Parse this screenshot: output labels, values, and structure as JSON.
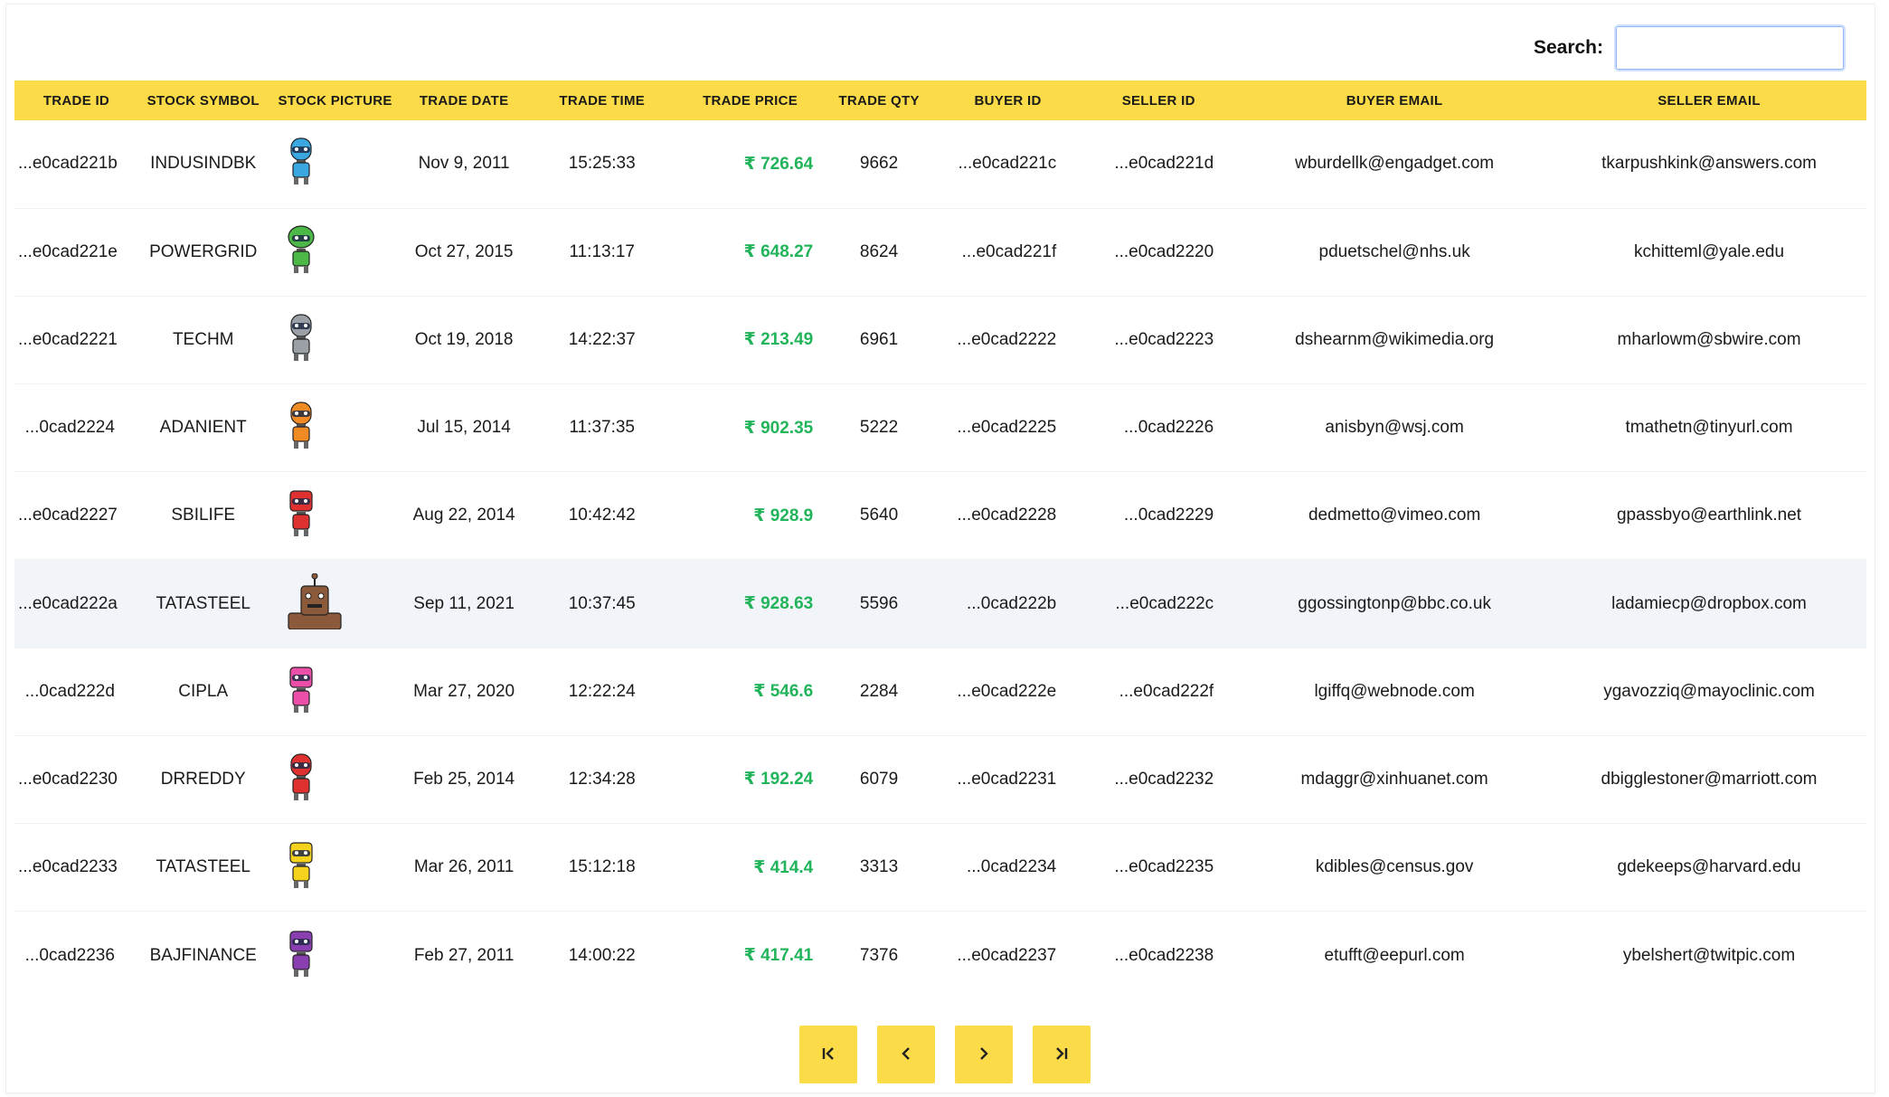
{
  "search": {
    "label": "Search:",
    "value": "",
    "placeholder": ""
  },
  "columns": [
    "TRADE ID",
    "STOCK SYMBOL",
    "STOCK PICTURE",
    "TRADE DATE",
    "TRADE TIME",
    "TRADE PRICE",
    "TRADE QTY",
    "BUYER ID",
    "SELLER ID",
    "BUYER EMAIL",
    "SELLER EMAIL"
  ],
  "currency_symbol": "₹",
  "rows": [
    {
      "trade_id": "...e0cad221b",
      "symbol": "INDUSINDBK",
      "robot_color": "#3aa7e0",
      "robot_head": "round",
      "date": "Nov 9, 2011",
      "time": "15:25:33",
      "price": "726.64",
      "qty": "9662",
      "buyer_id": "...e0cad221c",
      "seller_id": "...e0cad221d",
      "buyer_email": "wburdellk@engadget.com",
      "seller_email": "tkarpushkink@answers.com"
    },
    {
      "trade_id": "...e0cad221e",
      "symbol": "POWERGRID",
      "robot_color": "#4cb848",
      "robot_head": "alien",
      "date": "Oct 27, 2015",
      "time": "11:13:17",
      "price": "648.27",
      "qty": "8624",
      "buyer_id": "...e0cad221f",
      "seller_id": "...e0cad2220",
      "buyer_email": "pduetschel@nhs.uk",
      "seller_email": "kchitteml@yale.edu"
    },
    {
      "trade_id": "...e0cad2221",
      "symbol": "TECHM",
      "robot_color": "#9aa0a6",
      "robot_head": "round",
      "date": "Oct 19, 2018",
      "time": "14:22:37",
      "price": "213.49",
      "qty": "6961",
      "buyer_id": "...e0cad2222",
      "seller_id": "...e0cad2223",
      "buyer_email": "dshearnm@wikimedia.org",
      "seller_email": "mharlowm@sbwire.com"
    },
    {
      "trade_id": "...0cad2224",
      "symbol": "ADANIENT",
      "robot_color": "#f08a24",
      "robot_head": "round",
      "date": "Jul 15, 2014",
      "time": "11:37:35",
      "price": "902.35",
      "qty": "5222",
      "buyer_id": "...e0cad2225",
      "seller_id": "...0cad2226",
      "buyer_email": "anisbyn@wsj.com",
      "seller_email": "tmathetn@tinyurl.com"
    },
    {
      "trade_id": "...e0cad2227",
      "symbol": "SBILIFE",
      "robot_color": "#e03131",
      "robot_head": "square",
      "date": "Aug 22, 2014",
      "time": "10:42:42",
      "price": "928.9",
      "qty": "5640",
      "buyer_id": "...e0cad2228",
      "seller_id": "...0cad2229",
      "buyer_email": "dedmetto@vimeo.com",
      "seller_email": "gpassbyo@earthlink.net"
    },
    {
      "trade_id": "...e0cad222a",
      "symbol": "TATASTEEL",
      "robot_color": "#8a5a3a",
      "robot_head": "big",
      "date": "Sep 11, 2021",
      "time": "10:37:45",
      "price": "928.63",
      "qty": "5596",
      "buyer_id": "...0cad222b",
      "seller_id": "...e0cad222c",
      "buyer_email": "ggossingtonp@bbc.co.uk",
      "seller_email": "ladamiecp@dropbox.com"
    },
    {
      "trade_id": "...0cad222d",
      "symbol": "CIPLA",
      "robot_color": "#ec4fa8",
      "robot_head": "square",
      "date": "Mar 27, 2020",
      "time": "12:22:24",
      "price": "546.6",
      "qty": "2284",
      "buyer_id": "...e0cad222e",
      "seller_id": "...e0cad222f",
      "buyer_email": "lgiffq@webnode.com",
      "seller_email": "ygavozziq@mayoclinic.com"
    },
    {
      "trade_id": "...e0cad2230",
      "symbol": "DRREDDY",
      "robot_color": "#e03131",
      "robot_head": "round",
      "date": "Feb 25, 2014",
      "time": "12:34:28",
      "price": "192.24",
      "qty": "6079",
      "buyer_id": "...e0cad2231",
      "seller_id": "...e0cad2232",
      "buyer_email": "mdaggr@xinhuanet.com",
      "seller_email": "dbigglestoner@marriott.com"
    },
    {
      "trade_id": "...e0cad2233",
      "symbol": "TATASTEEL",
      "robot_color": "#f5d31c",
      "robot_head": "square",
      "date": "Mar 26, 2011",
      "time": "15:12:18",
      "price": "414.4",
      "qty": "3313",
      "buyer_id": "...0cad2234",
      "seller_id": "...e0cad2235",
      "buyer_email": "kdibles@census.gov",
      "seller_email": "gdekeeps@harvard.edu"
    },
    {
      "trade_id": "...0cad2236",
      "symbol": "BAJFINANCE",
      "robot_color": "#8a3fb0",
      "robot_head": "square",
      "date": "Feb 27, 2011",
      "time": "14:00:22",
      "price": "417.41",
      "qty": "7376",
      "buyer_id": "...e0cad2237",
      "seller_id": "...e0cad2238",
      "buyer_email": "etufft@eepurl.com",
      "seller_email": "ybelshert@twitpic.com"
    }
  ],
  "highlighted_row": 5,
  "pagination": {
    "buttons": [
      {
        "name": "first-page-button",
        "icon": "first-page-icon"
      },
      {
        "name": "prev-page-button",
        "icon": "chevron-left-icon"
      },
      {
        "name": "next-page-button",
        "icon": "chevron-right-icon"
      },
      {
        "name": "last-page-button",
        "icon": "last-page-icon"
      }
    ]
  },
  "colors": {
    "header_bg": "#fcdb48",
    "price": "#22b45a",
    "highlight_row": "#f1f4f8",
    "search_border": "#cfe0ff"
  }
}
